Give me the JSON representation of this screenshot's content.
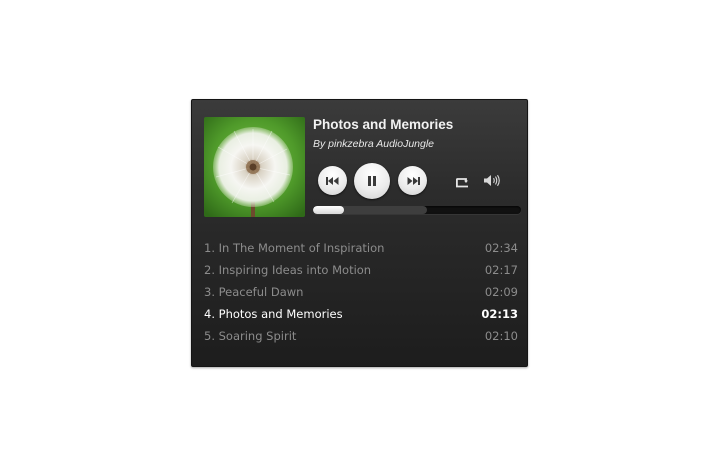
{
  "player": {
    "title": "Photos and Memories",
    "artist": "By pinkzebra AudioJungle",
    "cover_image": "dandelion-seed-head-on-green",
    "controls": {
      "previous": "rewind-icon",
      "play_pause": "pause-icon",
      "next": "fast-forward-icon",
      "repeat": "repeat-icon",
      "volume": "speaker-volume-icon"
    },
    "progress": {
      "played_fraction": 0.15,
      "loaded_fraction": 0.55
    },
    "colors": {
      "background_top": "#3b3b3b",
      "background_bottom": "#1d1d1d",
      "active_track": "#ffffff",
      "inactive_track": "#8c8c8c"
    }
  },
  "playlist": [
    {
      "label": "1. In The Moment of Inspiration",
      "duration": "02:34",
      "active": false
    },
    {
      "label": "2. Inspiring Ideas into Motion",
      "duration": "02:17",
      "active": false
    },
    {
      "label": "3. Peaceful Dawn",
      "duration": "02:09",
      "active": false
    },
    {
      "label": "4. Photos and Memories",
      "duration": "02:13",
      "active": true
    },
    {
      "label": "5. Soaring Spirit",
      "duration": "02:10",
      "active": false
    }
  ]
}
